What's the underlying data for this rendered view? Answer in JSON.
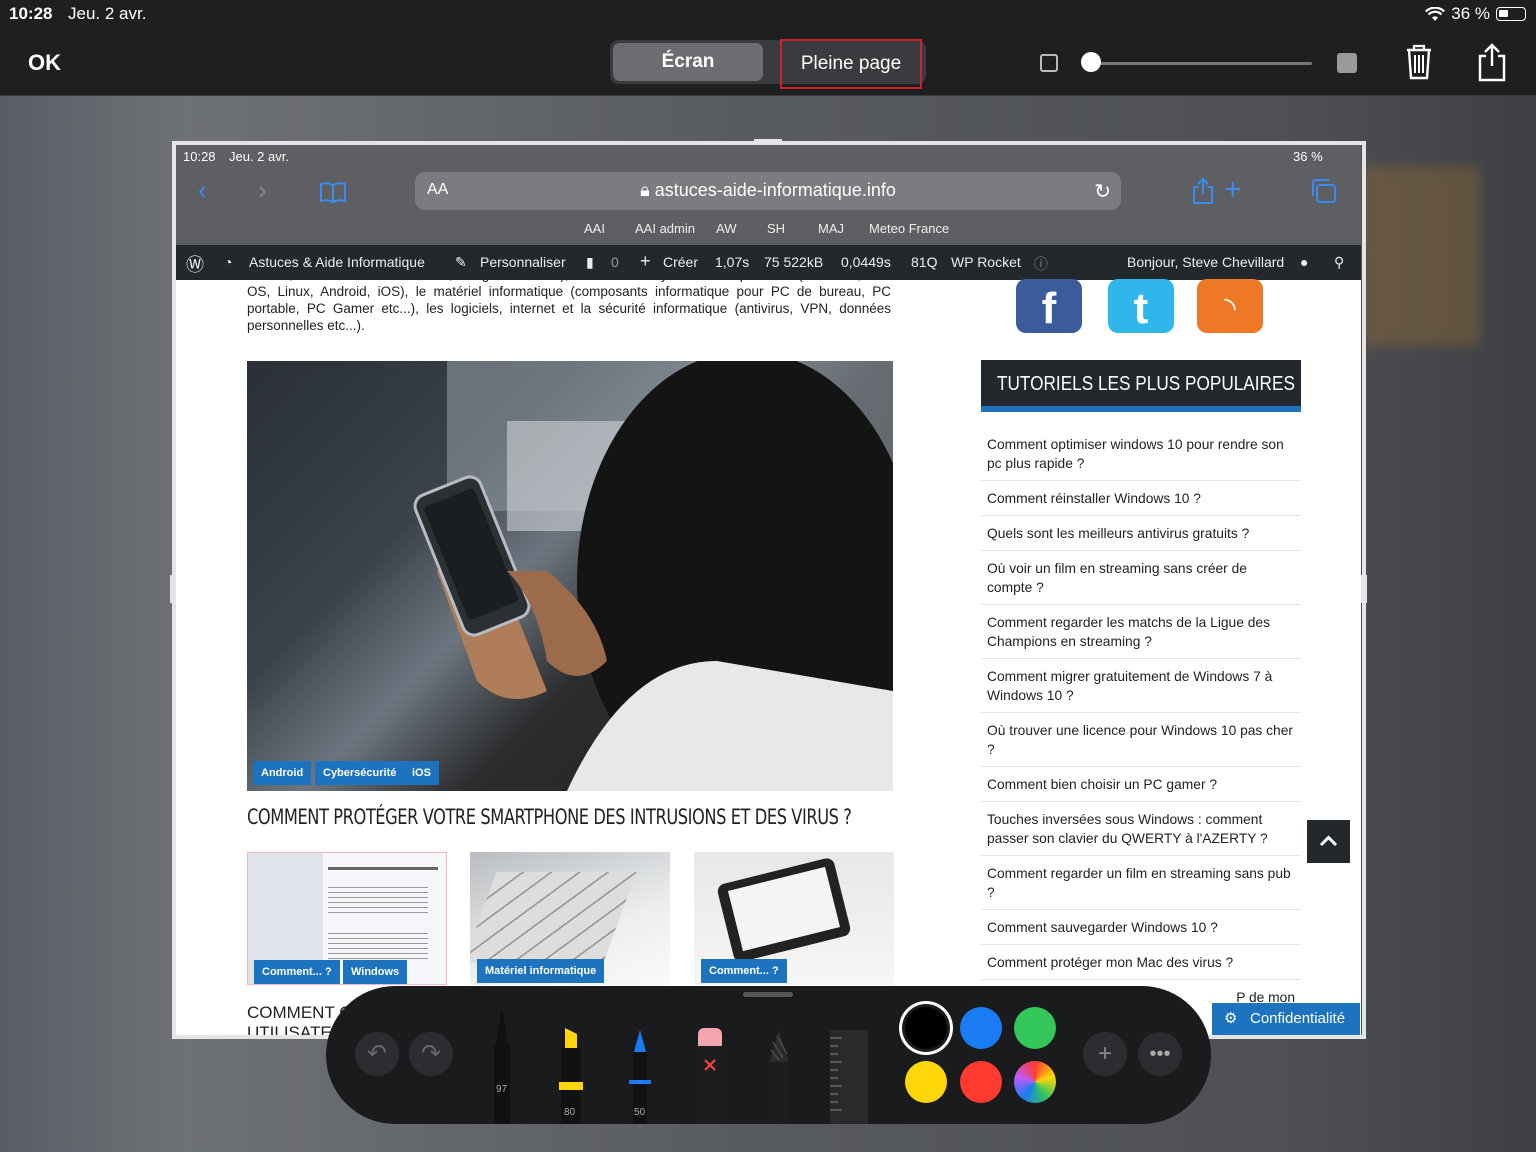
{
  "status_bar": {
    "time": "10:28",
    "date": "Jeu. 2 avr.",
    "battery": "36 %"
  },
  "toolbar": {
    "ok_label": "OK",
    "segments": [
      "Écran",
      "Pleine page"
    ],
    "selected_segment": "Écran",
    "opacity_level": 0.0
  },
  "screenshot": {
    "status_bar": {
      "time": "10:28",
      "date": "Jeu. 2 avr.",
      "battery": "36 %"
    },
    "safari": {
      "text_size": "AA",
      "url": "astuces-aide-informatique.info",
      "favorites": [
        "AAI",
        "AAI admin",
        "AW",
        "SH",
        "MAJ",
        "Meteo France"
      ]
    },
    "admin_bar": {
      "site": "Astuces & Aide Informatique",
      "customize": "Personnaliser",
      "comments": "0",
      "create": "Créer",
      "time": "1,07s",
      "size": "75 522kB",
      "query_time": "0,0449s",
      "queries": "81Q",
      "rocket": "WP Rocket",
      "greeting": "Bonjour, Steve Chevillard"
    },
    "article": {
      "intro_partial": "iPhone, tablettes Android ou iPad, navigateurs etc...), les différents systèmes d'exploitation (Windows, Mac OS, Linux, Android, iOS), le matériel informatique (composants informatique pour PC de bureau, PC portable, PC Gamer etc...), les logiciels, internet et la sécurité informatique (antivirus, VPN, données personnelles etc...).",
      "tags": [
        "Android",
        "Cybersécurité",
        "iOS"
      ],
      "headline": "COMMENT PROTÉGER VOTRE SMARTPHONE DES INTRUSIONS ET DES VIRUS ?",
      "thumbnails": [
        {
          "tags": [
            "Comment... ?",
            "Windows"
          ]
        },
        {
          "tags": [
            "Matériel informatique"
          ]
        },
        {
          "tags": [
            "Comment... ?"
          ]
        }
      ],
      "next_title_partial": "COMMENT CRÉ",
      "next_title_line2": "UTILISATEUR"
    },
    "sidebar": {
      "social": [
        "f",
        "t",
        "rss"
      ],
      "popular_title": "TUTORIELS LES PLUS POPULAIRES",
      "popular": [
        "Comment optimiser windows 10 pour rendre son pc plus rapide ?",
        "Comment réinstaller Windows 10 ?",
        "Quels sont les meilleurs antivirus gratuits ?",
        "Où voir un film en streaming sans créer de compte ?",
        "Comment regarder les matchs de la Ligue des Champions en streaming ?",
        "Comment migrer gratuitement de Windows 7 à Windows 10 ?",
        "Où trouver une licence pour Windows 10 pas cher ?",
        "Comment bien choisir un PC gamer ?",
        "Touches inversées sous Windows : comment passer son clavier du QWERTY à l'AZERTY ?",
        "Comment regarder un film en streaming sans pub ?",
        "Comment sauvegarder Windows 10 ?",
        "Comment protéger mon Mac des virus ?"
      ],
      "partial_item": "P de mon",
      "privacy_label": "Confidentialité"
    }
  },
  "markup": {
    "pen_width": "97",
    "marker_width": "80",
    "pencil_width": "50",
    "colors": [
      "#000000",
      "#1a7cf5",
      "#34c759",
      "#ffd60a",
      "#ff3b30",
      "color-wheel"
    ],
    "selected_color": "#000000"
  }
}
